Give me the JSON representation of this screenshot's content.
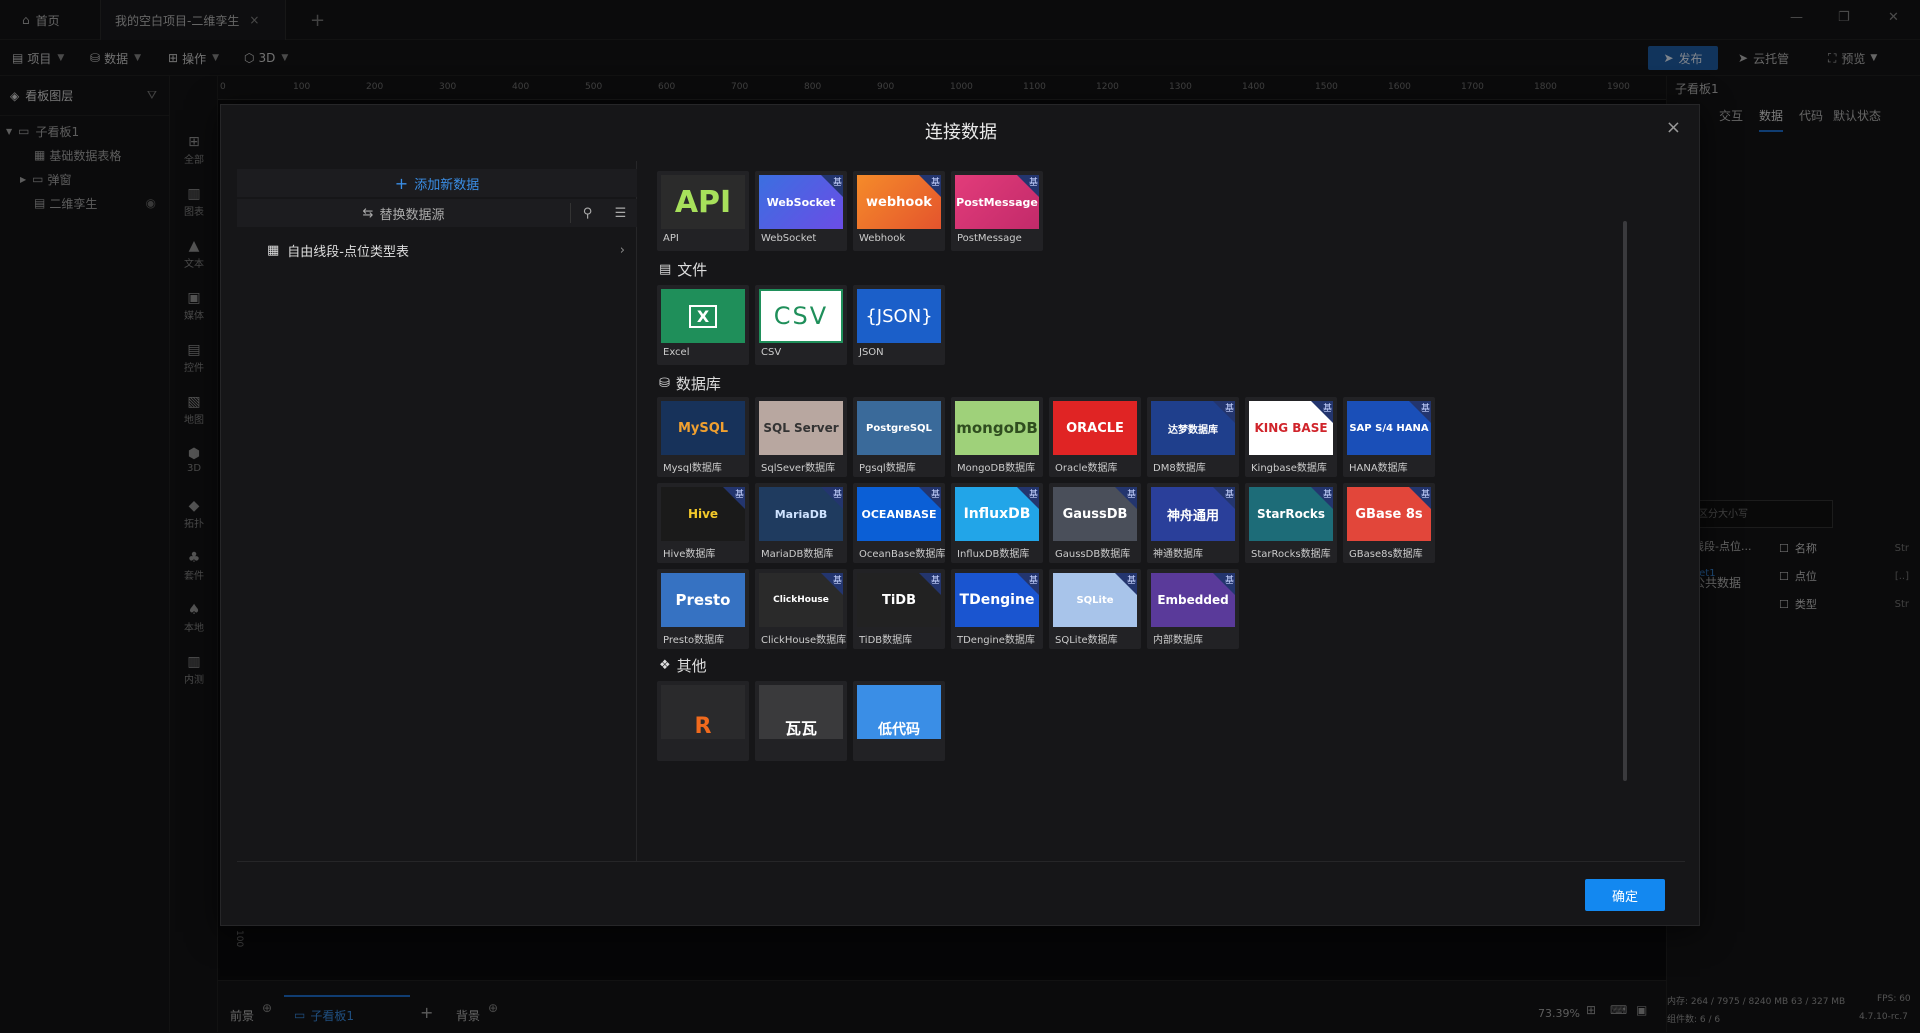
{
  "titlebar": {
    "home_tab": "首页",
    "project_tab": "我的空白项目-二维孪生",
    "close": "×",
    "add": "+",
    "min": "—",
    "max": "❐",
    "x": "✕"
  },
  "menubar": {
    "project": "项目",
    "data": "数据",
    "ops": "操作",
    "three_d": "3D",
    "publish": "发布",
    "cloud": "云托管",
    "preview": "预览"
  },
  "left_panel": {
    "title": "看板图层",
    "items": [
      "子看板1",
      "基础数据表格",
      "弹窗",
      "二维孪生"
    ]
  },
  "icon_bar": [
    "全部",
    "图表",
    "文本",
    "媒体",
    "控件",
    "地图",
    "3D",
    "拓扑",
    "套件",
    "本地",
    "内测"
  ],
  "ruler": [
    "0",
    "100",
    "200",
    "300",
    "400",
    "500",
    "600",
    "700",
    "800",
    "900",
    "1000",
    "1100",
    "1200",
    "1300",
    "1400",
    "1500",
    "1600",
    "1700",
    "1800",
    "1900"
  ],
  "vruler": "100",
  "bottom_bar": {
    "front": "前景",
    "board": "子看板1",
    "add": "+",
    "back": "背景",
    "zoom": "73.39%"
  },
  "right_panel": {
    "board": "子看板1",
    "tabs": [
      "交互",
      "数据",
      "代码"
    ],
    "state": "默认状态",
    "public_data": "公共数据",
    "search_placeholder": "区分大小写",
    "dataset": "线段-点位...",
    "sheet": "eet1",
    "fields": [
      {
        "name": "名称",
        "type": "Str"
      },
      {
        "name": "点位",
        "type": "[..]"
      },
      {
        "name": "类型",
        "type": "Str"
      }
    ],
    "memory": "内存: 264 / 7975 / 8240 MB  63 / 327 MB",
    "fps": "FPS: 60",
    "components": "组件数: 6 / 6",
    "version": "4.7.10-rc.7"
  },
  "modal": {
    "title": "连接数据",
    "close": "×",
    "add_data": "添加新数据",
    "swap_source": "替换数据源",
    "source_item": "自由线段-点位类型表",
    "confirm": "确定",
    "sections": {
      "file": "文件",
      "database": "数据库",
      "other": "其他"
    },
    "api_cards": [
      {
        "logo": "API",
        "name": "API"
      },
      {
        "logo": "WebSocket",
        "name": "WebSocket"
      },
      {
        "logo": "webhook",
        "name": "Webhook"
      },
      {
        "logo": "PostMessage",
        "name": "PostMessage"
      }
    ],
    "file_cards": [
      {
        "logo": "X",
        "name": "Excel"
      },
      {
        "logo": "CSV",
        "name": "CSV"
      },
      {
        "logo": "{JSON}",
        "name": "JSON"
      }
    ],
    "db_cards": [
      {
        "logo": "MySQL",
        "name": "Mysql数据库"
      },
      {
        "logo": "SQL Server",
        "name": "SqlSever数据库"
      },
      {
        "logo": "PostgreSQL",
        "name": "Pgsql数据库"
      },
      {
        "logo": "mongoDB",
        "name": "MongoDB数据库"
      },
      {
        "logo": "ORACLE",
        "name": "Oracle数据库"
      },
      {
        "logo": "达梦数据库",
        "name": "DM8数据库"
      },
      {
        "logo": "KING BASE",
        "name": "Kingbase数据库"
      },
      {
        "logo": "SAP S/4 HANA",
        "name": "HANA数据库"
      },
      {
        "logo": "Hive",
        "name": "Hive数据库"
      },
      {
        "logo": "MariaDB",
        "name": "MariaDB数据库"
      },
      {
        "logo": "OCEANBASE",
        "name": "OceanBase数据库"
      },
      {
        "logo": "InfluxDB",
        "name": "InfluxDB数据库"
      },
      {
        "logo": "GaussDB",
        "name": "GaussDB数据库"
      },
      {
        "logo": "神舟通用",
        "name": "神通数据库"
      },
      {
        "logo": "StarRocks",
        "name": "StarRocks数据库"
      },
      {
        "logo": "GBase 8s",
        "name": "GBase8s数据库"
      },
      {
        "logo": "Presto",
        "name": "Presto数据库"
      },
      {
        "logo": "ClickHouse",
        "name": "ClickHouse数据库"
      },
      {
        "logo": "TiDB",
        "name": "TiDB数据库"
      },
      {
        "logo": "TDengine",
        "name": "TDengine数据库"
      },
      {
        "logo": "SQLite",
        "name": "SQLite数据库"
      },
      {
        "logo": "Embedded",
        "name": "内部数据库"
      }
    ],
    "other_cards": [
      {
        "logo": "R",
        "name": ""
      },
      {
        "logo": "瓦瓦",
        "name": ""
      },
      {
        "logo": "低代码",
        "name": ""
      }
    ],
    "badge": "基"
  }
}
